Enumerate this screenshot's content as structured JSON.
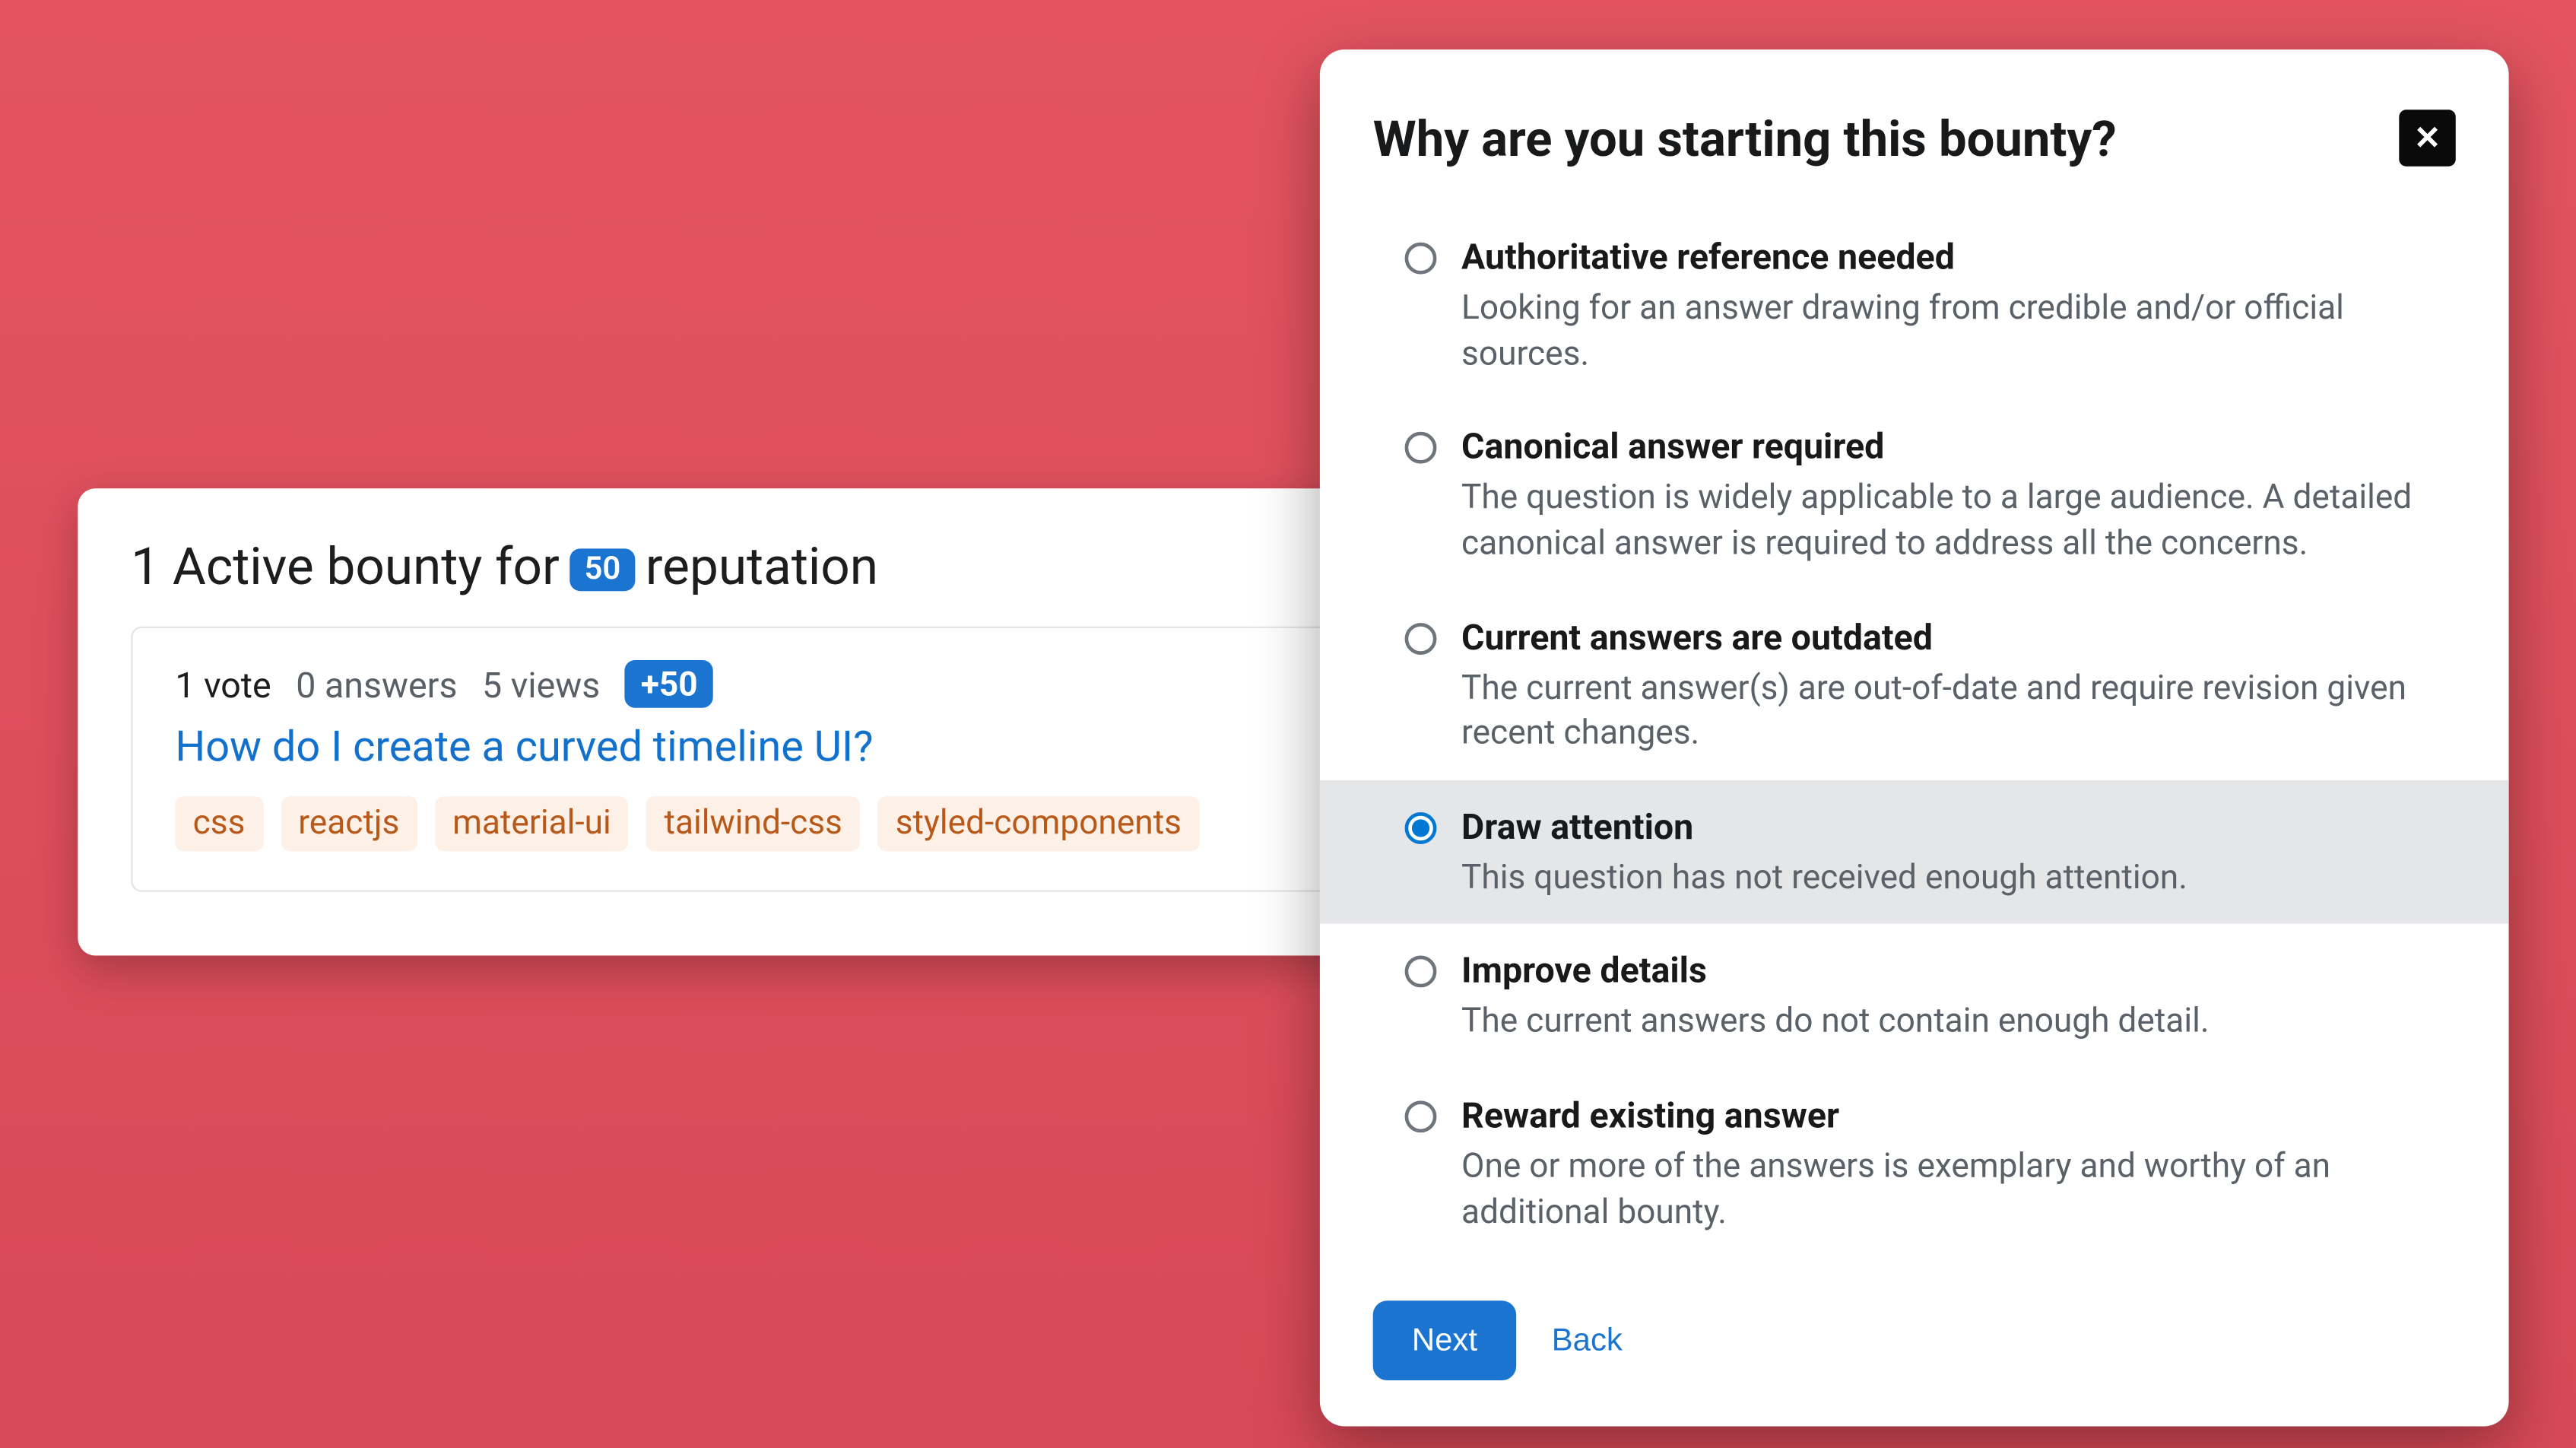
{
  "bounty_card": {
    "heading_prefix": "1 Active bounty for",
    "heading_rep": "50",
    "heading_suffix": "reputation",
    "question": {
      "votes": "1 vote",
      "answers": "0 answers",
      "views": "5 views",
      "bounty_badge": "+50",
      "title": "How do I create a curved timeline UI?",
      "tags": [
        "css",
        "reactjs",
        "material-ui",
        "tailwind-css",
        "styled-components"
      ]
    }
  },
  "modal": {
    "title": "Why are you starting this bounty?",
    "close_label": "✕",
    "selected_index": 3,
    "options": [
      {
        "title": "Authoritative reference needed",
        "desc": "Looking for an answer drawing from credible and/or official sources."
      },
      {
        "title": "Canonical answer required",
        "desc": "The question is widely applicable to a large audience. A detailed canonical answer is required to address all the concerns."
      },
      {
        "title": "Current answers are outdated",
        "desc": "The current answer(s) are out-of-date and require revision given recent changes."
      },
      {
        "title": "Draw attention",
        "desc": "This question has not received enough attention."
      },
      {
        "title": "Improve details",
        "desc": "The current answers do not contain enough detail."
      },
      {
        "title": "Reward existing answer",
        "desc": "One or more of the answers is exemplary and worthy of an additional bounty."
      }
    ],
    "next_label": "Next",
    "back_label": "Back"
  }
}
